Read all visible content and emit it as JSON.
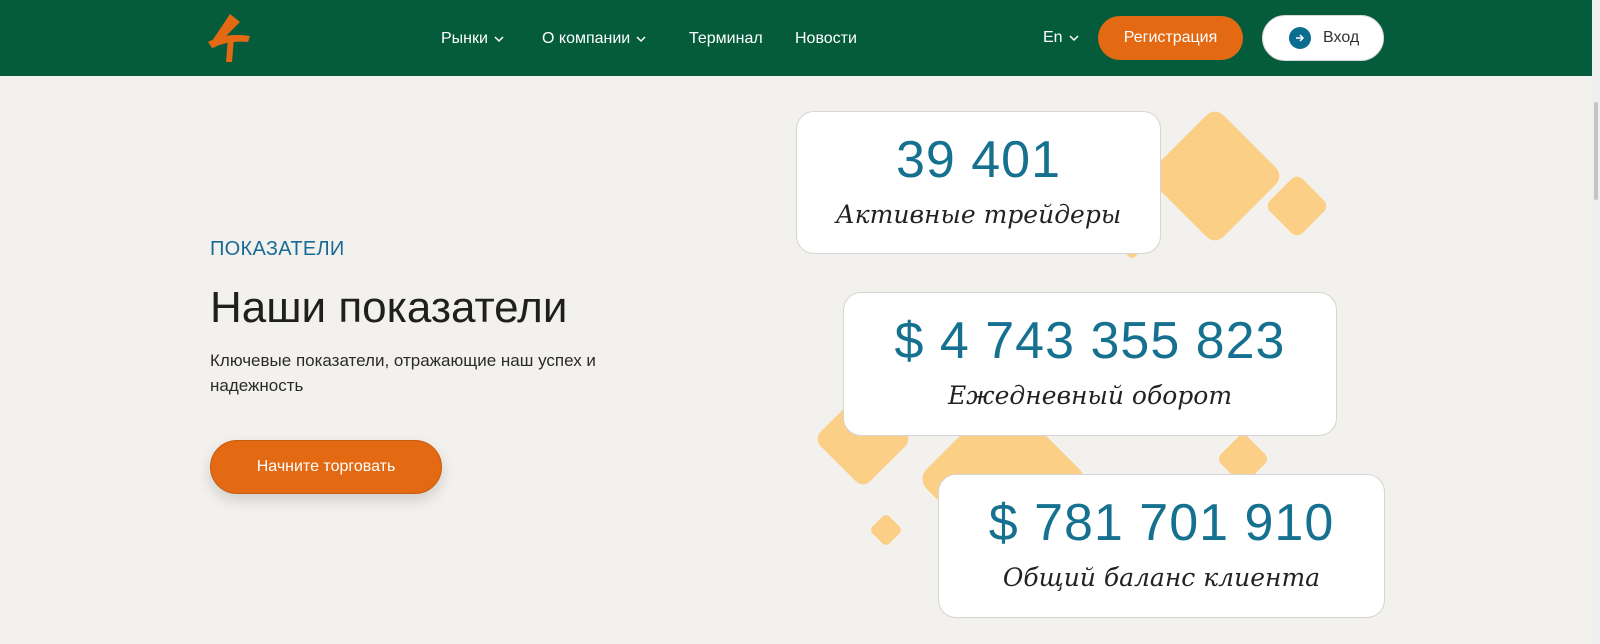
{
  "header": {
    "logo_name": "brand-logo",
    "nav": [
      {
        "label": "Рынки",
        "has_dropdown": true
      },
      {
        "label": "О компании",
        "has_dropdown": true
      },
      {
        "label": "Терминал",
        "has_dropdown": false
      },
      {
        "label": "Новости",
        "has_dropdown": false
      }
    ],
    "language": "En",
    "register_label": "Регистрация",
    "login_label": "Вход"
  },
  "hero": {
    "eyebrow": "ПОКАЗАТЕЛИ",
    "title": "Наши показатели",
    "description": "Ключевые показатели, отражающие наш успех и надежность",
    "cta_label": "Начните торговать"
  },
  "stats": [
    {
      "value": "39 401",
      "label": "Активные трейдеры"
    },
    {
      "value": "$ 4 743 355 823",
      "label": "Ежедневный оборот"
    },
    {
      "value": "$ 781 701 910",
      "label": "Общий баланс клиента"
    }
  ],
  "colors": {
    "header_bg": "#045c3c",
    "accent": "#e36a13",
    "stat_value": "#15718f",
    "decor": "#fbcf85"
  }
}
